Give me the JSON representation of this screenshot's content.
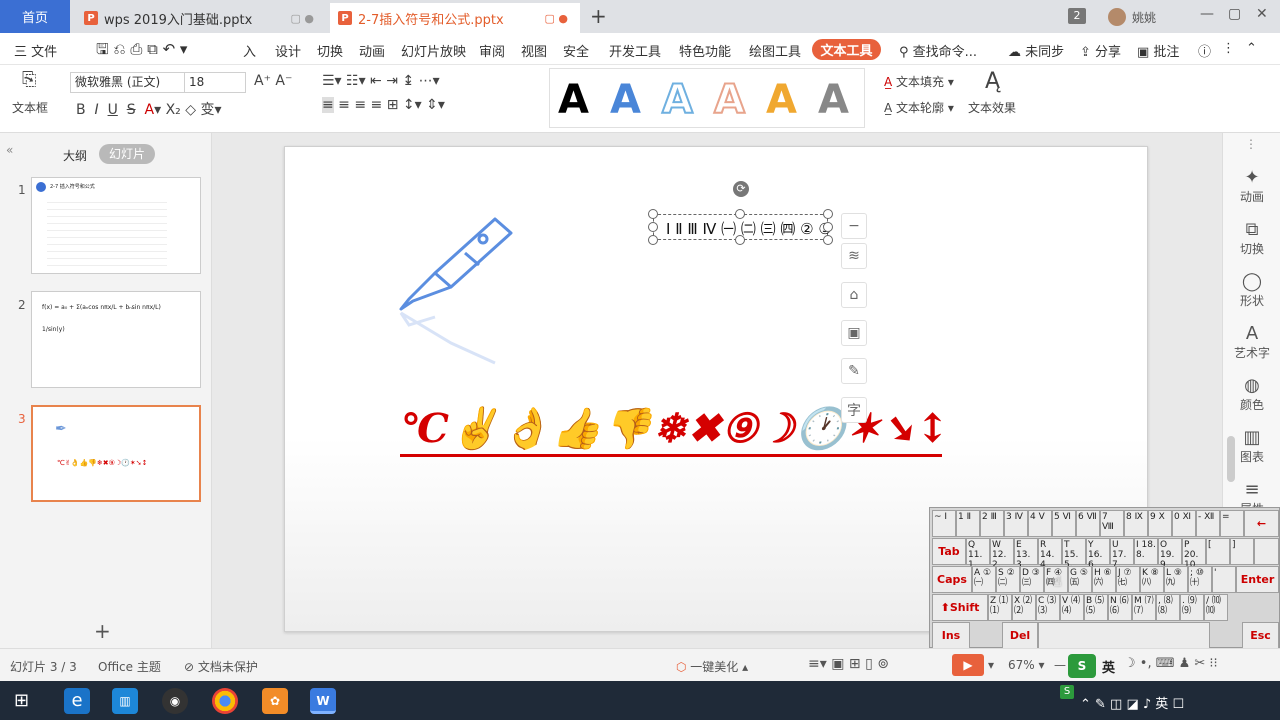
{
  "tabs": {
    "home": "首页",
    "doc1": "wps 2019入门基础.pptx",
    "doc2": "2-7插入符号和公式.pptx",
    "count": "2",
    "user": "姚姚"
  },
  "menu": {
    "file": "三 文件",
    "items": [
      "入",
      "设计",
      "切换",
      "动画",
      "幻灯片放映",
      "审阅",
      "视图",
      "安全",
      "开发工具",
      "特色功能",
      "绘图工具"
    ],
    "text_tool": "文本工具",
    "search": "查找命令...",
    "sync": "未同步",
    "share": "分享",
    "comment": "批注"
  },
  "ribbon": {
    "textbox_label": "文本框",
    "font_name": "微软雅黑 (正文)",
    "font_size": "18",
    "art_letter": "A",
    "text_fill": "文本填充",
    "text_outline": "文本轮廓",
    "text_effect": "文本效果",
    "art_colors": [
      "#000000",
      "#4a86d8",
      "#6fb0e0",
      "#e8a48c",
      "#f0a830",
      "#888888"
    ]
  },
  "left_panel": {
    "outline_tab": "大纲",
    "slides_tab": "幻灯片",
    "slide_numbers": [
      "1",
      "2",
      "3"
    ],
    "slide1_title": "2-7  插入符号和公式",
    "slide2_formula": "f(x) = a₀ + Σ(aₙcos nπx/L + bₙsin nπx/L)",
    "slide2_frac": "1/sin(y)",
    "slide3_symbols": "℃✌👌👍👎❄✖⑨☽🕐✶➘↕",
    "add_slide": "+"
  },
  "slide": {
    "textbox_text": "Ⅰ Ⅱ Ⅲ Ⅳ ㈠ ㈡ ㈢ ㈣ ② ③",
    "symbols": "℃✌👌👍👎❄✖⑨☽🕐✶➘↕",
    "symbol_color": "#d40000"
  },
  "float_tools": [
    "−",
    "≋",
    "⌂",
    "▣",
    "✎",
    "字"
  ],
  "right_panel": [
    {
      "icon": "✦",
      "label": "动画"
    },
    {
      "icon": "⧉",
      "label": "切换"
    },
    {
      "icon": "◯",
      "label": "形状"
    },
    {
      "icon": "A",
      "label": "艺术字"
    },
    {
      "icon": "◍",
      "label": "颜色"
    },
    {
      "icon": "▥",
      "label": "图表"
    },
    {
      "icon": "≡",
      "label": "属性"
    }
  ],
  "keyboard": {
    "row1": [
      "~ Ⅰ",
      "1 Ⅱ",
      "2 Ⅲ",
      "3 Ⅳ",
      "4 Ⅴ",
      "5 Ⅵ",
      "6 Ⅶ",
      "7 Ⅷ",
      "8 Ⅸ",
      "9 Ⅹ",
      "0 Ⅺ",
      "- Ⅻ",
      "="
    ],
    "backspace": "←",
    "tab": "Tab",
    "row2": [
      "Q 11. 1.",
      "W 12. 2.",
      "E 13. 3.",
      "R 14. 4.",
      "T 15. 5.",
      "Y 16. 6.",
      "U 17. 7.",
      "I 18. 8.",
      "O 19. 9.",
      "P 20. 10.",
      "[",
      "]"
    ],
    "caps": "Caps",
    "row3": [
      "A ① ㈠",
      "S ② ㈡",
      "D ③ ㈢",
      "F ④ ㈣",
      "G ⑤ ㈤",
      "H ⑥ ㈥",
      "J ⑦ ㈦",
      "K ⑧ ㈧",
      "L ⑨ ㈨",
      "; ⑩ ㈩",
      "' "
    ],
    "enter": "Enter",
    "shift": "Shift",
    "row4": [
      "Z ⑴ ⑴",
      "X ⑵ ⑵",
      "C ⑶ ⑶",
      "V ⑷ ⑷",
      "B ⑸ ⑸",
      "N ⑹ ⑹",
      "M ⑺ ⑺",
      ", ⑻ ⑻",
      ". ⑼ ⑼",
      "/ ⑽ ⑽"
    ],
    "ins": "Ins",
    "del": "Del",
    "esc": "Esc"
  },
  "status": {
    "slide_count": "幻灯片 3 / 3",
    "theme": "Office 主题",
    "protect": "文档未保护",
    "beautify": "一键美化",
    "zoom": "67%",
    "ime_lang": "英"
  }
}
